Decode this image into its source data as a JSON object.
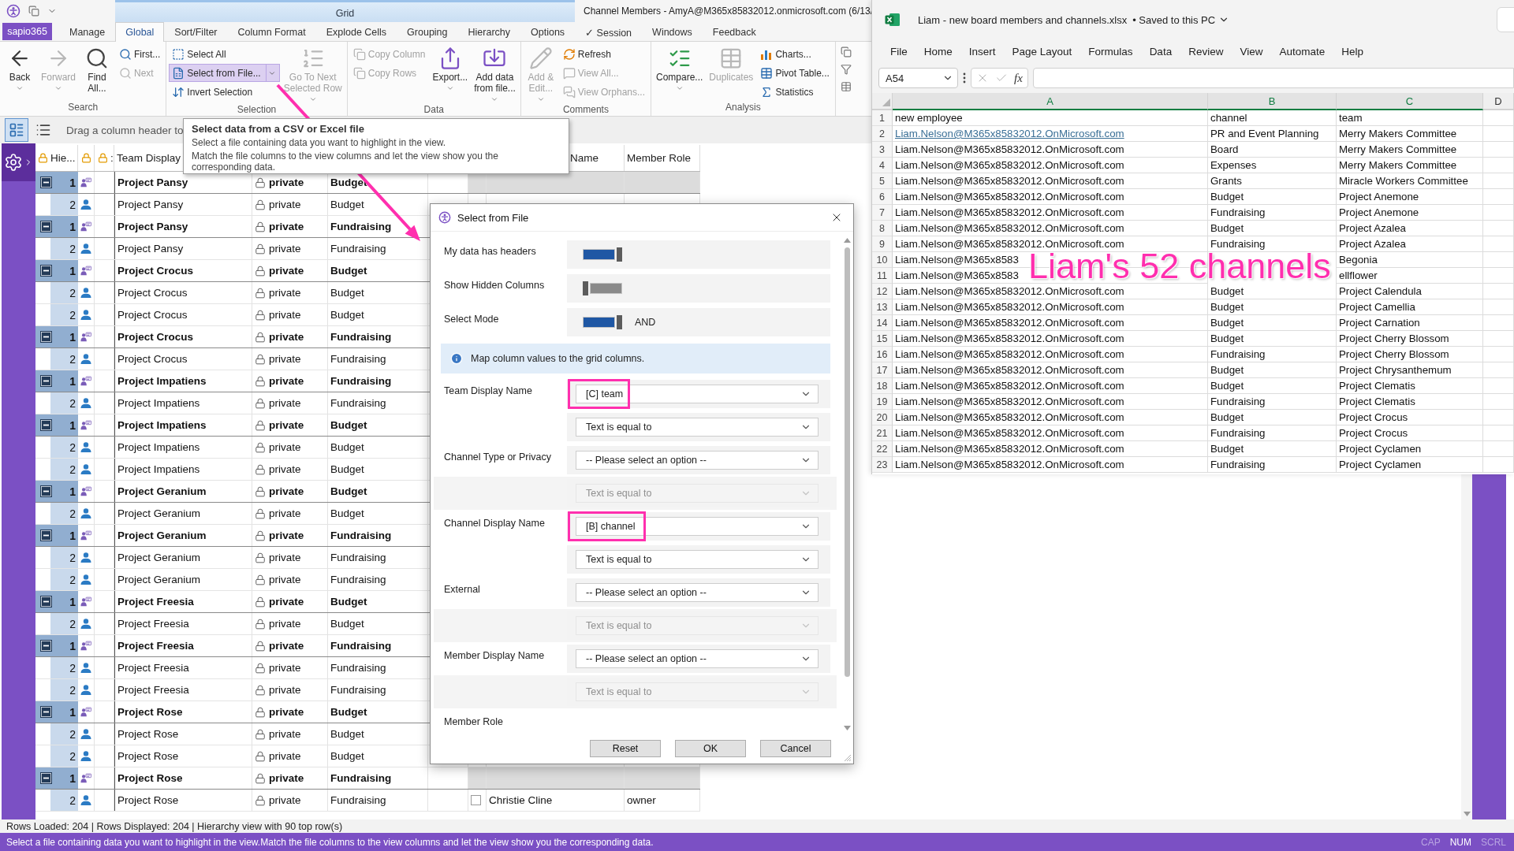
{
  "titlebar": {
    "context_tab": "Grid",
    "title": "Channel Members - AmyA@M365x85832012.onmicrosoft.com (6/13/"
  },
  "tabs": [
    {
      "kind": "app",
      "label": "sapio365"
    },
    {
      "kind": "tab",
      "label": "Manage",
      "selected": false
    },
    {
      "kind": "tab",
      "label": "Global",
      "selected": true
    },
    {
      "kind": "tab",
      "label": "Sort/Filter",
      "selected": false
    },
    {
      "kind": "tab",
      "label": "Column Format",
      "selected": false
    },
    {
      "kind": "tab",
      "label": "Explode Cells",
      "selected": false
    },
    {
      "kind": "tab",
      "label": "Grouping",
      "selected": false
    },
    {
      "kind": "tab",
      "label": "Hierarchy",
      "selected": false
    },
    {
      "kind": "tab",
      "label": "Options",
      "selected": false
    },
    {
      "kind": "tab",
      "label": "✓ Session",
      "selected": false
    },
    {
      "kind": "tab",
      "label": "Windows",
      "selected": false
    },
    {
      "kind": "tab",
      "label": "Feedback",
      "selected": false
    }
  ],
  "ribbon": {
    "groups": [
      {
        "label": "Search",
        "items": [
          {
            "kind": "large",
            "label": "Back",
            "disabled": false,
            "caret": true,
            "highlighted": false
          },
          {
            "kind": "large",
            "label": "Forward",
            "disabled": true,
            "caret": true,
            "highlighted": false
          },
          {
            "kind": "large",
            "label": "Find\nAll...",
            "disabled": false,
            "caret": false,
            "highlighted": false
          },
          {
            "kind": "small",
            "label": "First...",
            "disabled": false,
            "caret": false,
            "highlighted": false
          },
          {
            "kind": "small",
            "label": "Next",
            "disabled": true,
            "caret": false,
            "highlighted": false
          }
        ]
      },
      {
        "label": "Selection",
        "items": [
          {
            "kind": "small",
            "label": "Select All",
            "disabled": false,
            "caret": false,
            "highlighted": false
          },
          {
            "kind": "small",
            "label": "Select from File...",
            "disabled": false,
            "caret": true,
            "highlighted": true
          },
          {
            "kind": "small",
            "label": "Invert Selection",
            "disabled": false,
            "caret": false,
            "highlighted": false
          },
          {
            "kind": "large",
            "label": "Go To Next\nSelected Row",
            "disabled": true,
            "caret": true,
            "highlighted": false
          }
        ]
      },
      {
        "label": "Data",
        "items": [
          {
            "kind": "small",
            "label": "Copy Column",
            "disabled": true,
            "caret": false,
            "highlighted": false
          },
          {
            "kind": "small",
            "label": "Copy Rows",
            "disabled": true,
            "caret": false,
            "highlighted": false
          },
          {
            "kind": "large",
            "label": "Export...",
            "disabled": false,
            "caret": true,
            "highlighted": false
          },
          {
            "kind": "large",
            "label": "Add data\nfrom file...",
            "disabled": false,
            "caret": true,
            "highlighted": false
          }
        ]
      },
      {
        "label": "Comments",
        "items": [
          {
            "kind": "large",
            "label": "Add &\nEdit...",
            "disabled": true,
            "caret": true,
            "highlighted": false
          },
          {
            "kind": "small",
            "label": "Refresh",
            "disabled": false,
            "caret": false,
            "highlighted": false
          },
          {
            "kind": "small",
            "label": "View All...",
            "disabled": true,
            "caret": false,
            "highlighted": false
          },
          {
            "kind": "small",
            "label": "View Orphans...",
            "disabled": true,
            "caret": false,
            "highlighted": false
          }
        ]
      },
      {
        "label": "Analysis",
        "items": [
          {
            "kind": "large",
            "label": "Compare...",
            "disabled": false,
            "caret": true,
            "highlighted": false
          },
          {
            "kind": "large",
            "label": "Duplicates",
            "disabled": true,
            "caret": false,
            "highlighted": false
          },
          {
            "kind": "small",
            "label": "Charts...",
            "disabled": false,
            "caret": false,
            "highlighted": false
          },
          {
            "kind": "small",
            "label": "Pivot Table...",
            "disabled": false,
            "caret": false,
            "highlighted": false
          },
          {
            "kind": "small",
            "label": "Statistics",
            "disabled": false,
            "caret": false,
            "highlighted": false
          }
        ]
      }
    ]
  },
  "grid_toolbar": {
    "views": [
      {
        "selected": true
      },
      {
        "selected": false
      }
    ],
    "hint": "Drag a column header to"
  },
  "grid": {
    "header": {
      "hierarchy": "Hie...",
      "marker": ":",
      "team": "Team Display",
      "member": "Name",
      "role": "Member Role"
    },
    "rows": [
      {
        "level": "1",
        "expanded": true,
        "team": "Project Pansy",
        "privacy": "private",
        "channel": "Budget",
        "children": [
          {
            "level": "2",
            "team": "Project Pansy",
            "privacy": "private",
            "channel": "Budget"
          }
        ]
      },
      {
        "level": "1",
        "expanded": true,
        "team": "Project Pansy",
        "privacy": "private",
        "channel": "Fundraising",
        "children": [
          {
            "level": "2",
            "team": "Project Pansy",
            "privacy": "private",
            "channel": "Fundraising"
          }
        ]
      },
      {
        "level": "1",
        "expanded": true,
        "team": "Project Crocus",
        "privacy": "private",
        "channel": "Budget",
        "children": [
          {
            "level": "2",
            "team": "Project Crocus",
            "privacy": "private",
            "channel": "Budget"
          },
          {
            "level": "2",
            "team": "Project Crocus",
            "privacy": "private",
            "channel": "Budget"
          }
        ]
      },
      {
        "level": "1",
        "expanded": true,
        "team": "Project Crocus",
        "privacy": "private",
        "channel": "Fundraising",
        "children": [
          {
            "level": "2",
            "team": "Project Crocus",
            "privacy": "private",
            "channel": "Fundraising"
          }
        ]
      },
      {
        "level": "1",
        "expanded": true,
        "team": "Project Impatiens",
        "privacy": "private",
        "channel": "Fundraising",
        "children": [
          {
            "level": "2",
            "team": "Project Impatiens",
            "privacy": "private",
            "channel": "Fundraising"
          }
        ]
      },
      {
        "level": "1",
        "expanded": true,
        "team": "Project Impatiens",
        "privacy": "private",
        "channel": "Budget",
        "children": [
          {
            "level": "2",
            "team": "Project Impatiens",
            "privacy": "private",
            "channel": "Budget"
          },
          {
            "level": "2",
            "team": "Project Impatiens",
            "privacy": "private",
            "channel": "Budget"
          }
        ]
      },
      {
        "level": "1",
        "expanded": true,
        "team": "Project Geranium",
        "privacy": "private",
        "channel": "Budget",
        "children": [
          {
            "level": "2",
            "team": "Project Geranium",
            "privacy": "private",
            "channel": "Budget"
          }
        ]
      },
      {
        "level": "1",
        "expanded": true,
        "team": "Project Geranium",
        "privacy": "private",
        "channel": "Fundraising",
        "children": [
          {
            "level": "2",
            "team": "Project Geranium",
            "privacy": "private",
            "channel": "Fundraising"
          },
          {
            "level": "2",
            "team": "Project Geranium",
            "privacy": "private",
            "channel": "Fundraising"
          }
        ]
      },
      {
        "level": "1",
        "expanded": true,
        "team": "Project Freesia",
        "privacy": "private",
        "channel": "Budget",
        "children": [
          {
            "level": "2",
            "team": "Project Freesia",
            "privacy": "private",
            "channel": "Budget"
          }
        ]
      },
      {
        "level": "1",
        "expanded": true,
        "team": "Project Freesia",
        "privacy": "private",
        "channel": "Fundraising",
        "children": [
          {
            "level": "2",
            "team": "Project Freesia",
            "privacy": "private",
            "channel": "Fundraising"
          },
          {
            "level": "2",
            "team": "Project Freesia",
            "privacy": "private",
            "channel": "Fundraising"
          }
        ]
      },
      {
        "level": "1",
        "expanded": true,
        "team": "Project Rose",
        "privacy": "private",
        "channel": "Budget",
        "children": [
          {
            "level": "2",
            "team": "Project Rose",
            "privacy": "private",
            "channel": "Budget"
          },
          {
            "level": "2",
            "team": "Project Rose",
            "privacy": "private",
            "channel": "Budget"
          }
        ]
      },
      {
        "level": "1",
        "expanded": true,
        "team": "Project Rose",
        "privacy": "private",
        "channel": "Fundraising",
        "children": [
          {
            "level": "2",
            "team": "Project Rose",
            "privacy": "private",
            "channel": "Fundraising",
            "member": {
              "checked": false,
              "name": "Christie Cline",
              "role": "owner"
            }
          }
        ]
      }
    ]
  },
  "tooltip": {
    "title": "Select data from a CSV or Excel file",
    "lines": [
      "Select a file containing data you want to highlight in the view.",
      "Match the file columns to the view columns and let the view show you the corresponding data."
    ]
  },
  "dialog": {
    "title": "Select from File",
    "toggles": [
      {
        "label": "My data has headers",
        "on": true
      },
      {
        "label": "Show Hidden Columns",
        "on": false
      },
      {
        "label": "Select Mode",
        "on": true,
        "caption": "AND"
      }
    ],
    "info": "Map column values to the grid columns.",
    "mappings": [
      {
        "label": "Team Display Name",
        "column": "[C] team",
        "highlighted": true,
        "condition": "Text is equal to",
        "condition_disabled": false
      },
      {
        "label": "Channel Type or Privacy",
        "column": "-- Please select an option --",
        "highlighted": false,
        "condition": "Text is equal to",
        "condition_disabled": true
      },
      {
        "label": "Channel Display Name",
        "column": "[B] channel",
        "highlighted": true,
        "condition": "Text is equal to",
        "condition_disabled": false
      },
      {
        "label": "External",
        "column": "-- Please select an option --",
        "highlighted": false,
        "condition": "Text is equal to",
        "condition_disabled": true
      },
      {
        "label": "Member Display Name",
        "column": "-- Please select an option --",
        "highlighted": false,
        "condition": "Text is equal to",
        "condition_disabled": true
      },
      {
        "label": "Member Role"
      }
    ],
    "buttons": [
      "Reset",
      "OK",
      "Cancel"
    ]
  },
  "excel": {
    "title": "Liam - new board members and channels.xlsx",
    "save_status": "• Saved to this PC",
    "menu": [
      "File",
      "Home",
      "Insert",
      "Page Layout",
      "Formulas",
      "Data",
      "Review",
      "View",
      "Automate",
      "Help"
    ],
    "name_box": "A54",
    "formula_button": "fx",
    "columns": [
      {
        "label": "A",
        "selected": true
      },
      {
        "label": "B",
        "selected": true
      },
      {
        "label": "C",
        "selected": true
      },
      {
        "label": "D",
        "selected": false
      }
    ],
    "rows": [
      {
        "number": "1",
        "hyperlink": false,
        "a": "new employee",
        "b": "channel",
        "c": "team"
      },
      {
        "number": "2",
        "hyperlink": true,
        "a": "Liam.Nelson@M365x85832012.OnMicrosoft.com",
        "b": "PR and Event Planning",
        "c": "Merry Makers Committee"
      },
      {
        "number": "3",
        "hyperlink": false,
        "a": "Liam.Nelson@M365x85832012.OnMicrosoft.com",
        "b": "Board",
        "c": "Merry Makers Committee"
      },
      {
        "number": "4",
        "hyperlink": false,
        "a": "Liam.Nelson@M365x85832012.OnMicrosoft.com",
        "b": "Expenses",
        "c": "Merry Makers Committee"
      },
      {
        "number": "5",
        "hyperlink": false,
        "a": "Liam.Nelson@M365x85832012.OnMicrosoft.com",
        "b": "Grants",
        "c": "Miracle Workers Committee"
      },
      {
        "number": "6",
        "hyperlink": false,
        "a": "Liam.Nelson@M365x85832012.OnMicrosoft.com",
        "b": "Budget",
        "c": "Project Anemone"
      },
      {
        "number": "7",
        "hyperlink": false,
        "a": "Liam.Nelson@M365x85832012.OnMicrosoft.com",
        "b": "Fundraising",
        "c": "Project Anemone"
      },
      {
        "number": "8",
        "hyperlink": false,
        "a": "Liam.Nelson@M365x85832012.OnMicrosoft.com",
        "b": "Budget",
        "c": "Project Azalea"
      },
      {
        "number": "9",
        "hyperlink": false,
        "a": "Liam.Nelson@M365x85832012.OnMicrosoft.com",
        "b": "Fundraising",
        "c": "Project Azalea"
      },
      {
        "number": "10",
        "hyperlink": false,
        "a": "Liam.Nelson@M365x8583",
        "c": "Begonia"
      },
      {
        "number": "11",
        "hyperlink": false,
        "a": "Liam.Nelson@M365x8583",
        "c": "ellflower"
      },
      {
        "number": "12",
        "hyperlink": false,
        "a": "Liam.Nelson@M365x85832012.OnMicrosoft.com",
        "b": "Budget",
        "c": "Project Calendula"
      },
      {
        "number": "13",
        "hyperlink": false,
        "a": "Liam.Nelson@M365x85832012.OnMicrosoft.com",
        "b": "Budget",
        "c": "Project Camellia"
      },
      {
        "number": "14",
        "hyperlink": false,
        "a": "Liam.Nelson@M365x85832012.OnMicrosoft.com",
        "b": "Budget",
        "c": "Project Carnation"
      },
      {
        "number": "15",
        "hyperlink": false,
        "a": "Liam.Nelson@M365x85832012.OnMicrosoft.com",
        "b": "Budget",
        "c": "Project Cherry Blossom"
      },
      {
        "number": "16",
        "hyperlink": false,
        "a": "Liam.Nelson@M365x85832012.OnMicrosoft.com",
        "b": "Fundraising",
        "c": "Project Cherry Blossom"
      },
      {
        "number": "17",
        "hyperlink": false,
        "a": "Liam.Nelson@M365x85832012.OnMicrosoft.com",
        "b": "Budget",
        "c": "Project Chrysanthemum"
      },
      {
        "number": "18",
        "hyperlink": false,
        "a": "Liam.Nelson@M365x85832012.OnMicrosoft.com",
        "b": "Budget",
        "c": "Project Clematis"
      },
      {
        "number": "19",
        "hyperlink": false,
        "a": "Liam.Nelson@M365x85832012.OnMicrosoft.com",
        "b": "Fundraising",
        "c": "Project Clematis"
      },
      {
        "number": "20",
        "hyperlink": false,
        "a": "Liam.Nelson@M365x85832012.OnMicrosoft.com",
        "b": "Budget",
        "c": "Project Crocus"
      },
      {
        "number": "21",
        "hyperlink": false,
        "a": "Liam.Nelson@M365x85832012.OnMicrosoft.com",
        "b": "Fundraising",
        "c": "Project Crocus"
      },
      {
        "number": "22",
        "hyperlink": false,
        "a": "Liam.Nelson@M365x85832012.OnMicrosoft.com",
        "b": "Budget",
        "c": "Project Cyclamen"
      },
      {
        "number": "23",
        "hyperlink": false,
        "a": "Liam.Nelson@M365x85832012.OnMicrosoft.com",
        "b": "Fundraising",
        "c": "Project Cyclamen"
      }
    ]
  },
  "annotation": {
    "callout": "Liam's 52 channels"
  },
  "status": {
    "summary": "Rows Loaded: 204 | Rows Displayed: 204 | Hierarchy view with 90 top row(s)",
    "message": "Select a file containing data you want to highlight in the view.Match the file columns to the view columns and let the view show you the corresponding data.",
    "indicators": [
      {
        "label": "CAP",
        "on": false
      },
      {
        "label": "NUM",
        "on": true
      },
      {
        "label": "SCRL",
        "on": false
      }
    ]
  }
}
